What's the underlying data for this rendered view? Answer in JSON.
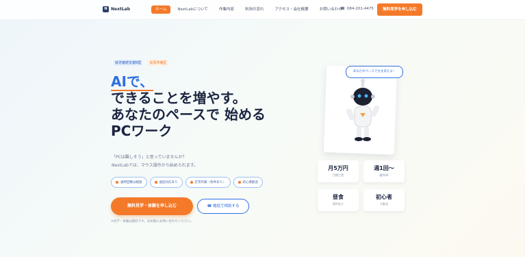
{
  "header": {
    "logo_text": "NextLab",
    "nav": [
      "ホーム",
      "NextLabについて",
      "作業内容",
      "利用の流れ",
      "アクセス・会社概要",
      "お問い合わせ"
    ],
    "phone": "084-201-4475",
    "cta": "無料見学を申し込む"
  },
  "hero": {
    "tags": [
      "就労継続支援B型",
      "広島市南区"
    ],
    "headline_accent": "AIで、",
    "headline_lines": [
      "できることを増やす。",
      "あなたのペースで 始める",
      "PCワーク"
    ],
    "sub_lines": [
      "「PCは難しそう」と思っていませんか？",
      "NextLabでは、マウス操作から始められます。"
    ],
    "chips": [
      "通所回数は相談",
      "送迎対応あり",
      "在宅作業（条件あり）",
      "初心者歓迎"
    ],
    "cta_main": "無料見学・体験を申し込む",
    "cta_phone": "電話で相談する",
    "note": "※見学・体験は無料です。お気軽にお問い合わせください。"
  },
  "robot": {
    "bubble": "あなたのペースで大丈夫だよ！"
  },
  "stats": [
    {
      "value": "月5万円",
      "label": "目標工賃"
    },
    {
      "value": "週1回〜",
      "label": "通所OK"
    },
    {
      "value": "昼食",
      "label": "提供あり"
    },
    {
      "value": "初心者",
      "label": "大歓迎"
    }
  ],
  "colors": {
    "accent": "#f47a2a",
    "primary": "#2f6fe0",
    "text": "#1b2540"
  }
}
